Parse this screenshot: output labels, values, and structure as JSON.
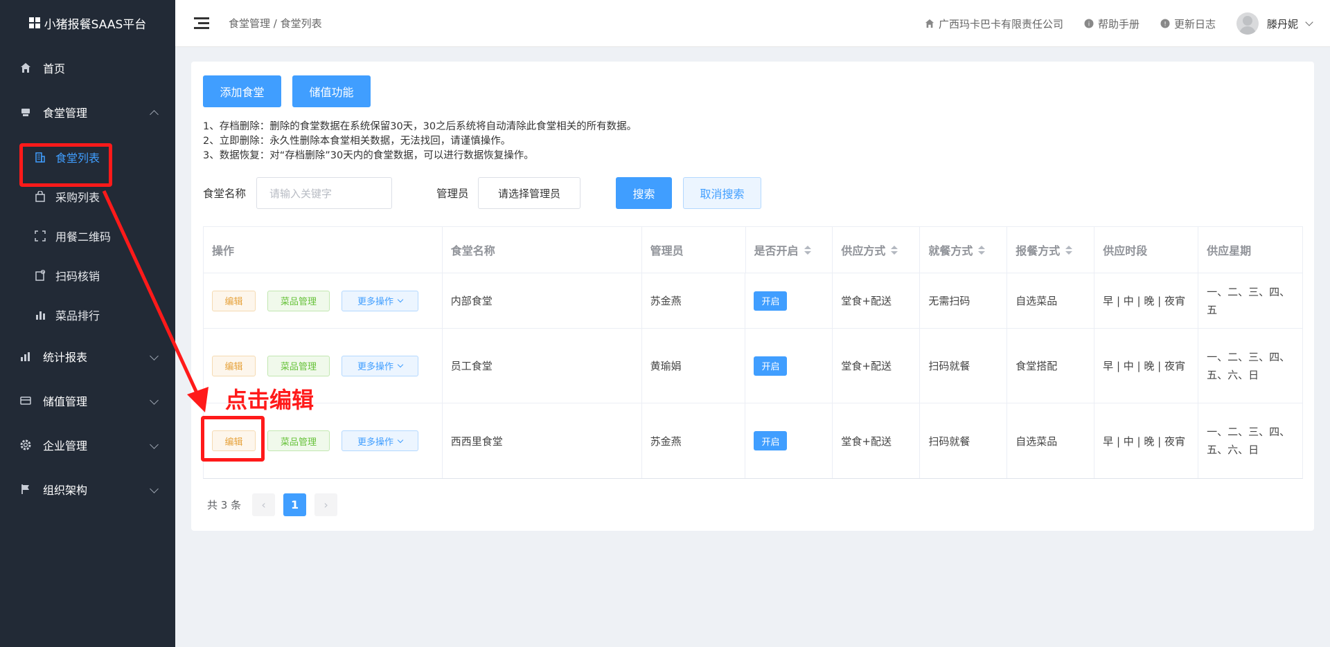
{
  "sidebar": {
    "logo": "小猪报餐SAAS平台",
    "items": [
      {
        "label": "首页",
        "icon": "home-icon"
      },
      {
        "label": "食堂管理",
        "icon": "canteen-icon",
        "expanded": true,
        "children": [
          {
            "label": "食堂列表",
            "icon": "building-icon",
            "active": true
          },
          {
            "label": "采购列表",
            "icon": "bag-icon"
          },
          {
            "label": "用餐二维码",
            "icon": "scan-icon"
          },
          {
            "label": "扫码核销",
            "icon": "verify-icon"
          },
          {
            "label": "菜品排行",
            "icon": "bar-chart-icon"
          }
        ]
      },
      {
        "label": "统计报表",
        "icon": "stats-icon"
      },
      {
        "label": "储值管理",
        "icon": "card-icon"
      },
      {
        "label": "企业管理",
        "icon": "gear-icon"
      },
      {
        "label": "组织架构",
        "icon": "flag-icon"
      }
    ]
  },
  "header": {
    "breadcrumb": "食堂管理 / 食堂列表",
    "company": "广西玛卡巴卡有限责任公司",
    "help": "帮助手册",
    "changelog": "更新日志",
    "username": "滕丹妮"
  },
  "toolbar": {
    "add_label": "添加食堂",
    "recharge_label": "储值功能"
  },
  "notes": [
    "1、存档删除：删除的食堂数据在系统保留30天，30之后系统将自动清除此食堂相关的所有数据。",
    "2、立即删除：永久性删除本食堂相关数据，无法找回，请谨慎操作。",
    "3、数据恢复：对“存档删除”30天内的食堂数据，可以进行数据恢复操作。"
  ],
  "search": {
    "name_label": "食堂名称",
    "name_placeholder": "请输入关键字",
    "admin_label": "管理员",
    "admin_select": "请选择管理员",
    "search_btn": "搜索",
    "cancel_btn": "取消搜索"
  },
  "table": {
    "columns": [
      "操作",
      "食堂名称",
      "管理员",
      "是否开启",
      "供应方式",
      "就餐方式",
      "报餐方式",
      "供应时段",
      "供应星期"
    ],
    "action_labels": {
      "edit": "编辑",
      "dish": "菜品管理",
      "more": "更多操作"
    },
    "rows": [
      {
        "name": "内部食堂",
        "admin": "苏金燕",
        "status": "开启",
        "supply": "堂食+配送",
        "dining": "无需扫码",
        "order": "自选菜品",
        "period": "早 | 中 | 晚 | 夜宵",
        "weekdays": "一、二、三、四、五"
      },
      {
        "name": "员工食堂",
        "admin": "黄瑜娟",
        "status": "开启",
        "supply": "堂食+配送",
        "dining": "扫码就餐",
        "order": "食堂搭配",
        "period": "早 | 中 | 晚 | 夜宵",
        "weekdays": "一、二、三、四、五、六、日"
      },
      {
        "name": "西西里食堂",
        "admin": "苏金燕",
        "status": "开启",
        "supply": "堂食+配送",
        "dining": "扫码就餐",
        "order": "自选菜品",
        "period": "早 | 中 | 晚 | 夜宵",
        "weekdays": "一、二、三、四、五、六、日"
      }
    ]
  },
  "pagination": {
    "total_text": "共 3 条",
    "current_page": "1"
  },
  "annotation": {
    "text": "点击编辑",
    "color": "#ff1a1a"
  }
}
